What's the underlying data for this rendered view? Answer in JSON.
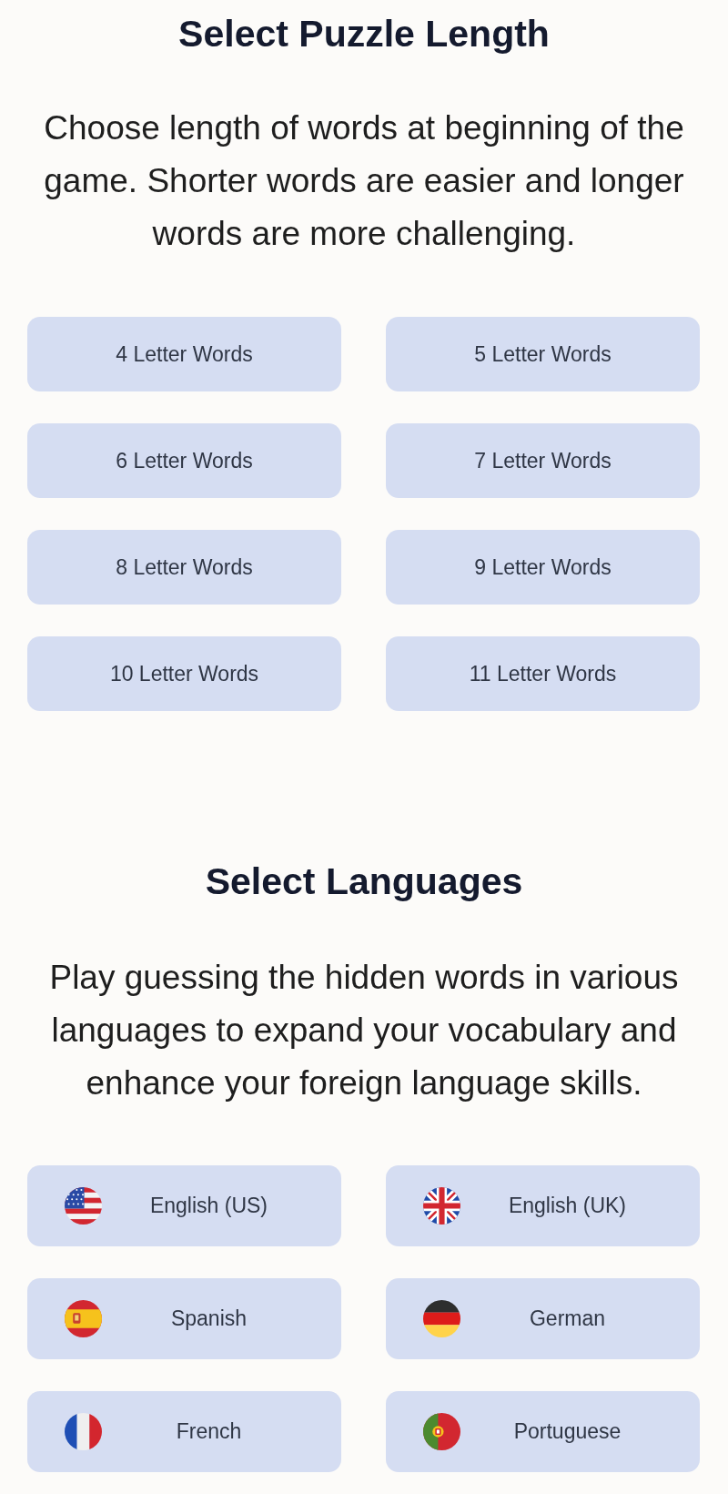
{
  "puzzle_length": {
    "title": "Select Puzzle Length",
    "description": "Choose length of words at beginning of the game. Shorter words are easier and longer words are more challenging.",
    "options": [
      {
        "label": "4 Letter Words"
      },
      {
        "label": "5 Letter Words"
      },
      {
        "label": "6 Letter Words"
      },
      {
        "label": "7 Letter Words"
      },
      {
        "label": "8 Letter Words"
      },
      {
        "label": "9 Letter Words"
      },
      {
        "label": "10 Letter Words"
      },
      {
        "label": "11 Letter Words"
      }
    ]
  },
  "languages": {
    "title": "Select Languages",
    "description": "Play guessing the hidden words in various languages to expand your vocabulary and enhance your foreign language skills.",
    "options": [
      {
        "label": "English (US)",
        "kind": "us"
      },
      {
        "label": "English (UK)",
        "kind": "uk"
      },
      {
        "label": "Spanish",
        "kind": "spain"
      },
      {
        "label": "German",
        "kind": "germany"
      },
      {
        "label": "French",
        "kind": "france"
      },
      {
        "label": "Portuguese",
        "kind": "portugal"
      }
    ]
  }
}
